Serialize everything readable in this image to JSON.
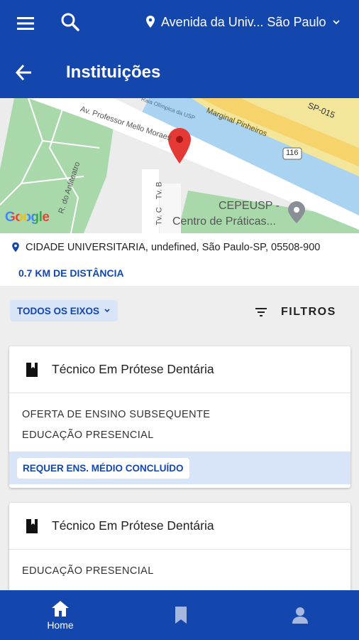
{
  "topbar": {
    "location": "Avenida da Univ... São Paulo",
    "icons": [
      "menu-icon",
      "search-icon",
      "location-pin-icon",
      "chevron-down-icon"
    ]
  },
  "page": {
    "title": "Instituições"
  },
  "map": {
    "labels": {
      "avenue": "Av. Professor Mello Moraes",
      "raia": "Raia Olímpica da USP",
      "marginal": "Marginal Pinheiros",
      "sp015": "SP-015",
      "route": "116",
      "anfiteatro": "R. do Anfiteatro",
      "tvb": "Tv. B",
      "tvc": "Tv. C",
      "cepeusp1": "CEPEUSP -",
      "cepeusp2": "Centro de Práticas...",
      "google": "Google"
    }
  },
  "address": {
    "text": "CIDADE UNIVERSITARIA, undefined, São Paulo-SP, 05508-900",
    "distance": "0.7 KM DE DISTÂNCIA"
  },
  "filter": {
    "axis_label": "TODOS OS EIXOS",
    "filters_label": "FILTROS"
  },
  "cards": [
    {
      "title": "Técnico Em Prótese Dentária",
      "lines": [
        "OFERTA DE ENSINO SUBSEQUENTE",
        "EDUCAÇÃO PRESENCIAL"
      ],
      "requirement": "REQUER ENS. MÉDIO CONCLUÍDO"
    },
    {
      "title": "Técnico Em Prótese Dentária",
      "lines": [
        "EDUCAÇÃO PRESENCIAL"
      ]
    }
  ],
  "bottom_nav": {
    "home_label": "Home"
  },
  "colors": {
    "primary": "#1447ad",
    "chip_bg": "#d8e4f7",
    "background": "#eeeeee"
  }
}
